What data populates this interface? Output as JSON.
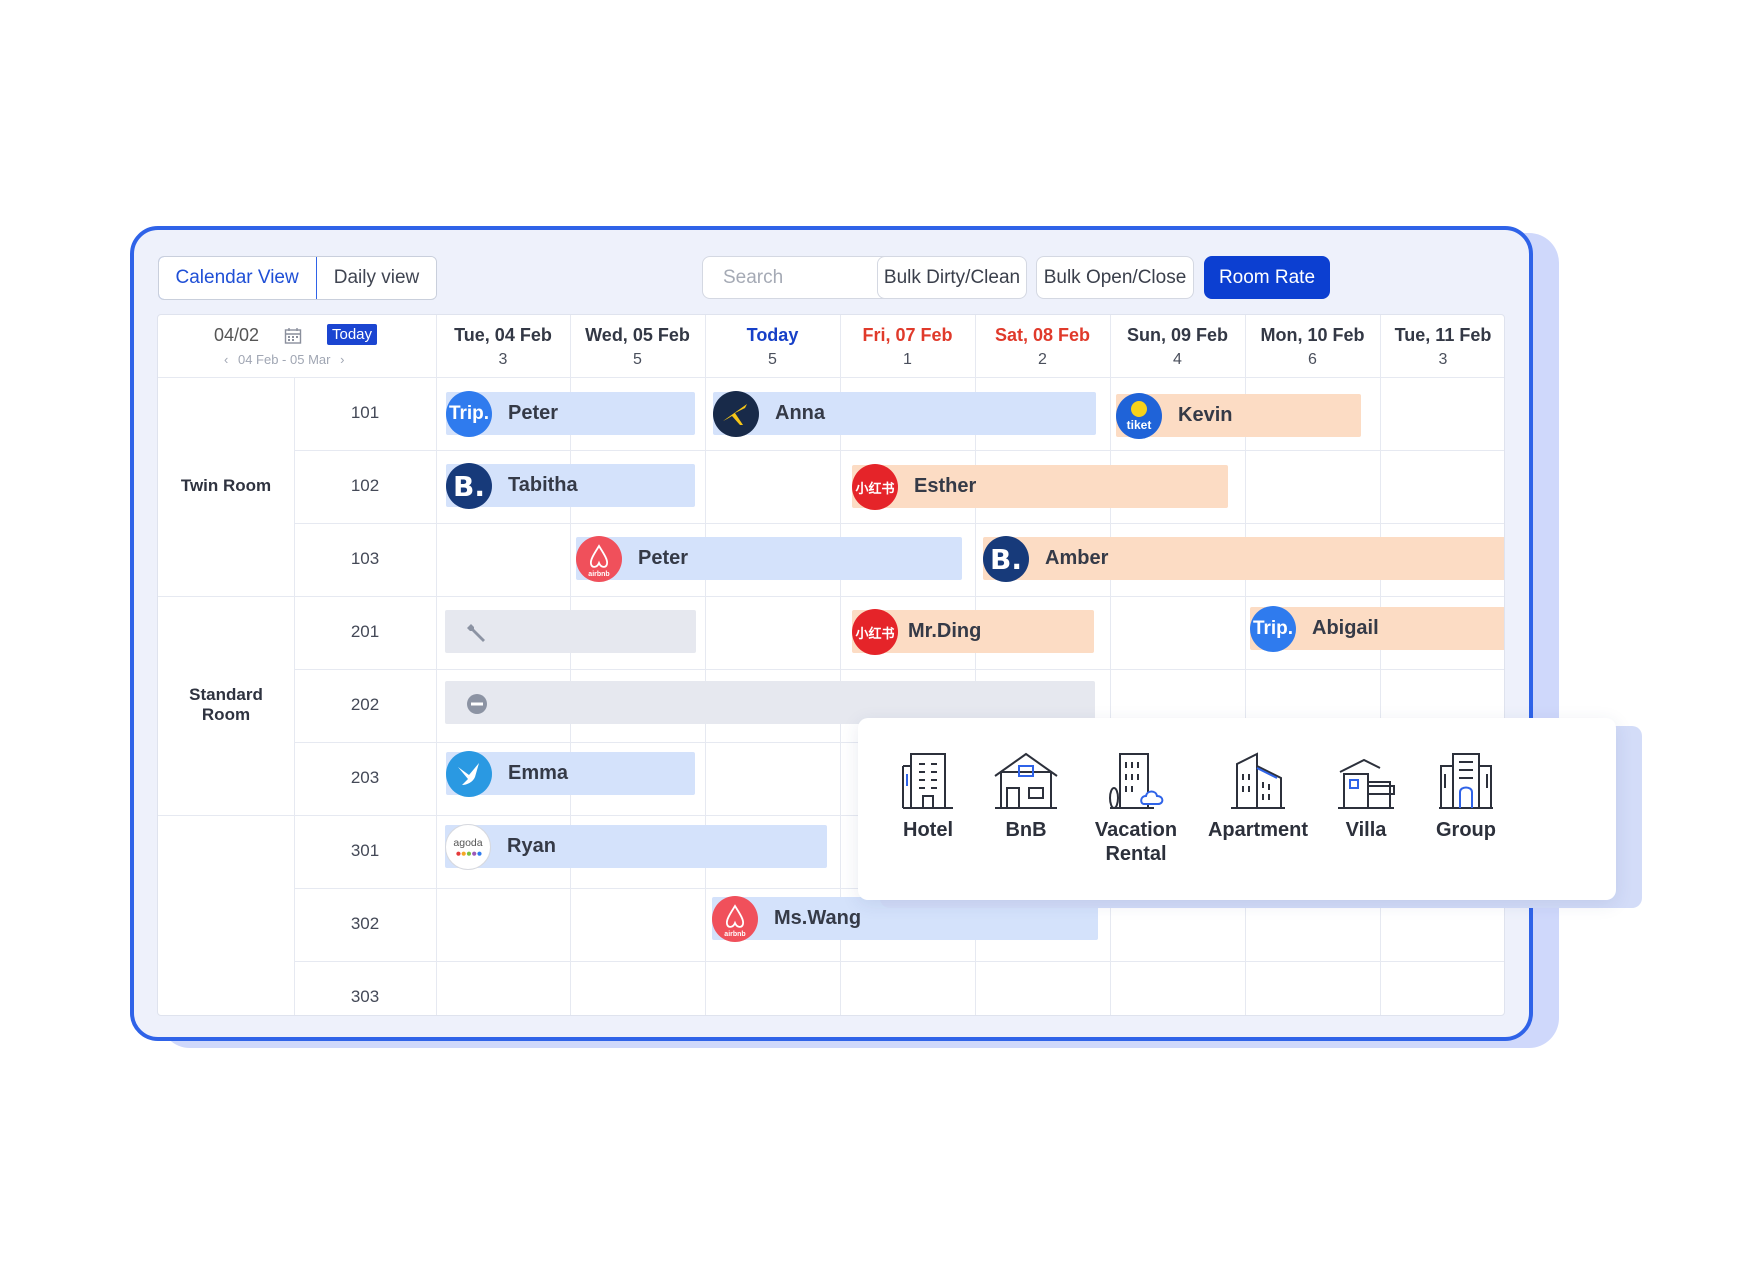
{
  "toolbar": {
    "view_tabs": [
      "Calendar View",
      "Daily view"
    ],
    "search_placeholder": "Search",
    "bulk_dirty_clean": "Bulk Dirty/Clean",
    "bulk_open_close": "Bulk Open/Close",
    "room_rate": "Room Rate"
  },
  "colors": {
    "accent": "#0c3fd1",
    "weekend": "#e03a2b",
    "booking_blue": "#d4e2fb",
    "booking_orange": "#fcdcc4"
  },
  "date_picker": {
    "date": "04/02",
    "today_label": "Today",
    "range": "04 Feb - 05 Mar",
    "prev": "‹",
    "next": "›"
  },
  "days": [
    {
      "name": "Tue, 04 Feb",
      "count": "3",
      "kind": "normal"
    },
    {
      "name": "Wed, 05 Feb",
      "count": "5",
      "kind": "normal"
    },
    {
      "name": "Today",
      "count": "5",
      "kind": "today"
    },
    {
      "name": "Fri, 07 Feb",
      "count": "1",
      "kind": "weekend"
    },
    {
      "name": "Sat, 08 Feb",
      "count": "2",
      "kind": "weekend"
    },
    {
      "name": "Sun, 09 Feb",
      "count": "4",
      "kind": "normal"
    },
    {
      "name": "Mon, 10 Feb",
      "count": "6",
      "kind": "normal"
    },
    {
      "name": "Tue, 11 Feb",
      "count": "3",
      "kind": "normal"
    }
  ],
  "room_types": [
    {
      "name": "Twin Room",
      "rooms": [
        "101",
        "102",
        "103"
      ]
    },
    {
      "name": "Standard Room",
      "rooms": [
        "201",
        "202",
        "203"
      ]
    },
    {
      "name": "",
      "rooms": [
        "301",
        "302",
        "303"
      ]
    }
  ],
  "bookings": [
    {
      "guest": "Peter",
      "room": "101",
      "channel": "trip",
      "channel_text": "Trip.",
      "color": "blue"
    },
    {
      "guest": "Anna",
      "room": "101",
      "channel": "expedia",
      "channel_text": "",
      "color": "blue"
    },
    {
      "guest": "Kevin",
      "room": "101",
      "channel": "tiket",
      "channel_text": "tiket",
      "color": "orange"
    },
    {
      "guest": "Tabitha",
      "room": "102",
      "channel": "booking",
      "channel_text": "B.",
      "color": "blue"
    },
    {
      "guest": "Esther",
      "room": "102",
      "channel": "xiaohongshu",
      "channel_text": "小红书",
      "color": "orange"
    },
    {
      "guest": "Peter",
      "room": "103",
      "channel": "airbnb",
      "channel_text": "airbnb",
      "color": "blue"
    },
    {
      "guest": "Amber",
      "room": "103",
      "channel": "booking",
      "channel_text": "B.",
      "color": "orange"
    },
    {
      "guest": "",
      "room": "201",
      "channel": "maintenance",
      "channel_text": "",
      "color": "gray",
      "icon": "wrench-icon"
    },
    {
      "guest": "Mr.Ding",
      "room": "201",
      "channel": "xiaohongshu",
      "channel_text": "小红书",
      "color": "orange"
    },
    {
      "guest": "Abigail",
      "room": "201",
      "channel": "trip",
      "channel_text": "Trip.",
      "color": "orange"
    },
    {
      "guest": "",
      "room": "202",
      "channel": "blocked",
      "channel_text": "",
      "color": "gray",
      "icon": "minus-circle-icon"
    },
    {
      "guest": "Emma",
      "room": "203",
      "channel": "bird",
      "channel_text": "",
      "color": "blue"
    },
    {
      "guest": "Ryan",
      "room": "301",
      "channel": "agoda",
      "channel_text": "agoda",
      "color": "blue"
    },
    {
      "guest": "Ms.Wang",
      "room": "302",
      "channel": "airbnb",
      "channel_text": "airbnb",
      "color": "blue"
    }
  ],
  "property_types": [
    {
      "label": "Hotel",
      "icon": "hotel-icon"
    },
    {
      "label": "BnB",
      "icon": "bnb-icon"
    },
    {
      "label": "Vacation Rental",
      "icon": "vacation-rental-icon"
    },
    {
      "label": "Apartment",
      "icon": "apartment-icon"
    },
    {
      "label": "Villa",
      "icon": "villa-icon"
    },
    {
      "label": "Group",
      "icon": "group-icon"
    }
  ]
}
